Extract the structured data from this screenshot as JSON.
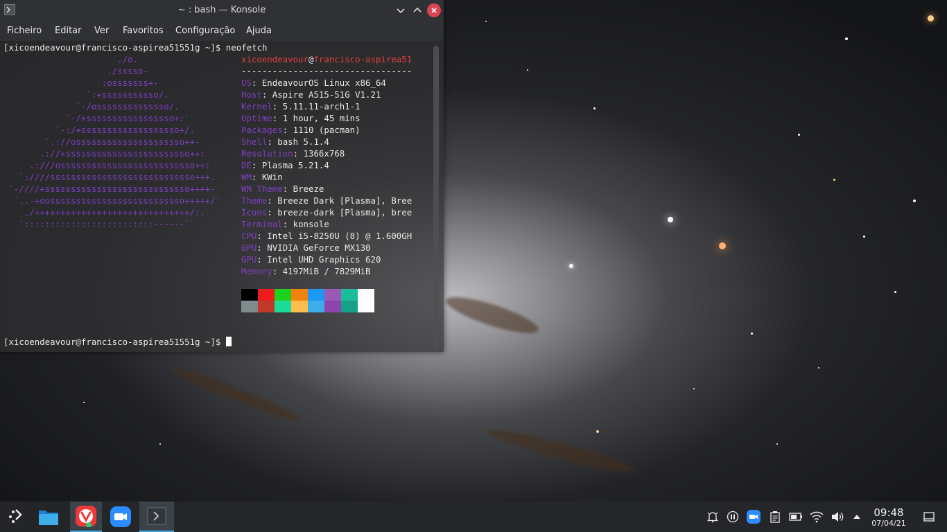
{
  "window": {
    "title": "~ : bash — Konsole",
    "menu": [
      "Ficheiro",
      "Editar",
      "Ver",
      "Favoritos",
      "Configuração",
      "Ajuda"
    ]
  },
  "terminal": {
    "prompt1": "[xicoendeavour@francisco-aspirea51551g ~]$ ",
    "command1": "neofetch",
    "user": "xicoendeavour",
    "at": "@",
    "host": "francisco-aspirea51",
    "separator": "---------------------------------",
    "logo": [
      "                      ./o.",
      "                    ./sssso-",
      "                  `:osssssss+-",
      "                `:+sssssssssso/.",
      "              `-/ossssssssssssso/.",
      "            `-/+sssssssssssssssso+:`",
      "          `-:/+sssssssssssssssssso+/.",
      "        `.://osssssssssssssssssssso++-",
      "       .://+ssssssssssssssssssssssso++:",
      "     .:///ossssssssssssssssssssssssso++:",
      "   `:////ssssssssssssssssssssssssssso+++.",
      " `-////+ssssssssssssssssssssssssssso++++-",
      "  `..-+oossssssssssssssssssssssssso+++++/`",
      "    ./++++++++++++++++++++++++++++++/:.",
      "   `:::::::::::::::::::::::::------``"
    ],
    "info": [
      {
        "label": "OS",
        "value": ": EndeavourOS Linux x86_64"
      },
      {
        "label": "Host",
        "value": ": Aspire A515-51G V1.21"
      },
      {
        "label": "Kernel",
        "value": ": 5.11.11-arch1-1"
      },
      {
        "label": "Uptime",
        "value": ": 1 hour, 45 mins"
      },
      {
        "label": "Packages",
        "value": ": 1110 (pacman)"
      },
      {
        "label": "Shell",
        "value": ": bash 5.1.4"
      },
      {
        "label": "Resolution",
        "value": ": 1366x768"
      },
      {
        "label": "DE",
        "value": ": Plasma 5.21.4"
      },
      {
        "label": "WM",
        "value": ": KWin"
      },
      {
        "label": "WM Theme",
        "value": ": Breeze"
      },
      {
        "label": "Theme",
        "value": ": Breeze Dark [Plasma], Bree"
      },
      {
        "label": "Icons",
        "value": ": breeze-dark [Plasma], bree"
      },
      {
        "label": "Terminal",
        "value": ": konsole"
      },
      {
        "label": "CPU",
        "value": ": Intel i5-8250U (8) @ 1.600GH"
      },
      {
        "label": "GPU",
        "value": ": NVIDIA GeForce MX130"
      },
      {
        "label": "GPU",
        "value": ": Intel UHD Graphics 620"
      },
      {
        "label": "Memory",
        "value": ": 4197MiB / 7829MiB"
      }
    ],
    "colors_top": [
      "#000000",
      "#ee1c1c",
      "#1cd21c",
      "#f2820e",
      "#1d99f3",
      "#9b59b6",
      "#1abc9c",
      "#fcfcfc"
    ],
    "colors_bottom": [
      "#7f8c8d",
      "#c0392b",
      "#1cdc9a",
      "#fdbc4b",
      "#3daee9",
      "#8e44ad",
      "#16a085",
      "#ffffff"
    ],
    "prompt2": "[xicoendeavour@francisco-aspirea51551g ~]$ "
  },
  "taskbar": {
    "time": "09:48",
    "date": "07/04/21"
  }
}
